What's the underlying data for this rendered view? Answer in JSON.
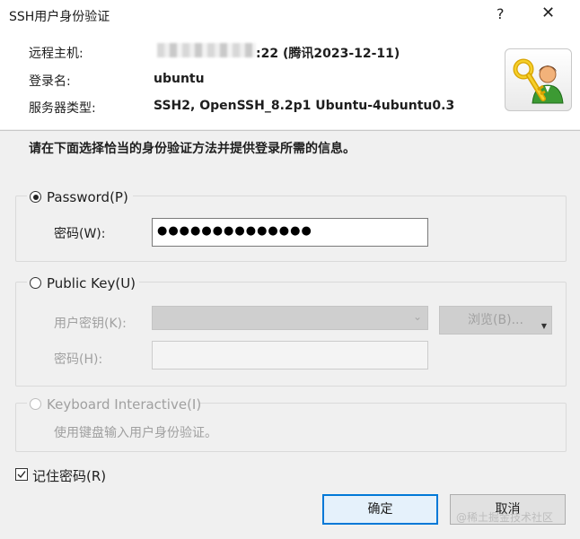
{
  "window": {
    "title": "SSH用户身份验证",
    "help_label": "?",
    "close_label": "✕"
  },
  "info": {
    "host_label": "远程主机:",
    "host_value": ":22 (腾讯2023-12-11)",
    "login_label": "登录名:",
    "login_value": "ubuntu",
    "server_type_label": "服务器类型:",
    "server_type_value": "SSH2, OpenSSH_8.2p1 Ubuntu-4ubuntu0.3"
  },
  "instruction": "请在下面选择恰当的身份验证方法并提供登录所需的信息。",
  "password_group": {
    "radio_label": "Password(P)",
    "field_label": "密码(W):",
    "field_value": "●●●●●●●●●●●●●●"
  },
  "pubkey_group": {
    "radio_label": "Public Key(U)",
    "user_key_label": "用户密钥(K):",
    "browse_label": "浏览(B)...",
    "passphrase_label": "密码(H):"
  },
  "keyboard_group": {
    "radio_label": "Keyboard Interactive(I)",
    "description": "使用键盘输入用户身份验证。"
  },
  "remember": {
    "label": "记住密码(R)",
    "checked": true
  },
  "buttons": {
    "ok": "确定",
    "cancel": "取消"
  },
  "watermark": "@稀土掘金技术社区",
  "colors": {
    "accent": "#0078d7",
    "window_bg": "#f0f0f0",
    "header_bg": "#ffffff"
  },
  "icons": {
    "auth": "key-user-icon",
    "dropdown": "chevron-down-icon"
  }
}
